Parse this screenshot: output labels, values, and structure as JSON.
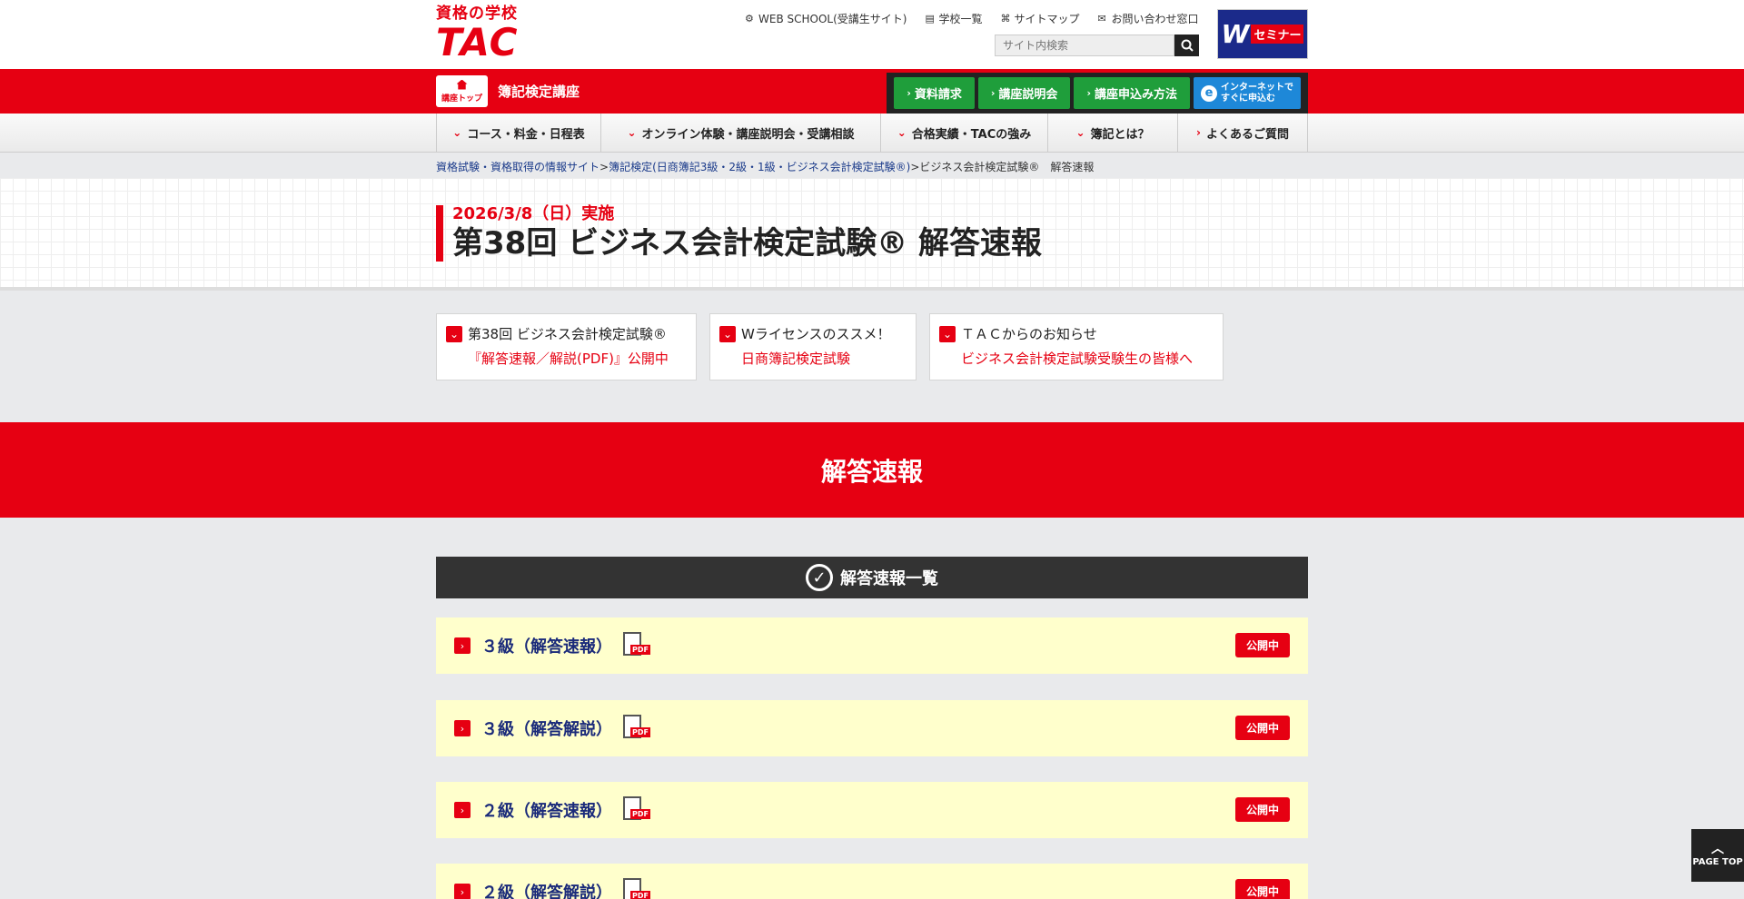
{
  "logo": {
    "sub": "資格の学校",
    "main": "TAC"
  },
  "util_links": [
    {
      "icon": "gear-icon",
      "glyph": "⚙",
      "label": "WEB SCHOOL(受講生サイト)"
    },
    {
      "icon": "building-icon",
      "glyph": "▤",
      "label": "学校一覧"
    },
    {
      "icon": "sitemap-icon",
      "glyph": "⌘",
      "label": "サイトマップ"
    },
    {
      "icon": "mail-icon",
      "glyph": "✉",
      "label": "お問い合わせ窓口"
    }
  ],
  "search": {
    "placeholder": "サイト内検索"
  },
  "w_banner": {
    "w": "W",
    "label": "セミナー"
  },
  "course_bar": {
    "top_label": "講座トップ",
    "course_name": "簿記検定講座"
  },
  "cta": [
    {
      "label": "資料請求"
    },
    {
      "label": "講座説明会"
    },
    {
      "label": "講座申込み方法"
    }
  ],
  "cta_internet": {
    "line1": "インターネットで",
    "line2": "すぐに申込む"
  },
  "nav": [
    {
      "label": "コース・料金・日程表",
      "chev": "⌄"
    },
    {
      "label": "オンライン体験・講座説明会・受講相談",
      "chev": "⌄"
    },
    {
      "label": "合格実績・TACの強み",
      "chev": "⌄"
    },
    {
      "label": "簿記とは？",
      "chev": "⌄"
    },
    {
      "label": "よくあるご質問",
      "chev": "›"
    }
  ],
  "breadcrumb": {
    "link1": "資格試験・資格取得の情報サイト",
    "sep": ">",
    "link2": "簿記検定(日商簿記3級・2級・1級・ビジネス会計検定試験®)",
    "current": "ビジネス会計検定試験®　解答速報"
  },
  "title": {
    "date": "2026/3/8（日）実施",
    "main": "第38回 ビジネス会計検定試験® 解答速報"
  },
  "news_cards": [
    {
      "line1": "第38回 ビジネス会計検定試験®",
      "line2": "『解答速報／解説(PDF)』公開中"
    },
    {
      "line1": "Wライセンスのススメ！",
      "line2": "日商簿記検定試験"
    },
    {
      "line1": "ＴＡＣからのお知らせ",
      "line2": "ビジネス会計検定試験受験生の皆様へ"
    }
  ],
  "section": {
    "heading": "解答速報"
  },
  "list": {
    "heading": "解答速報一覧",
    "rows": [
      {
        "label": "３級（解答速報）",
        "status": "公開中"
      },
      {
        "label": "３級（解答解説）",
        "status": "公開中"
      },
      {
        "label": "２級（解答速報）",
        "status": "公開中"
      },
      {
        "label": "２級（解答解説）",
        "status": "公開中"
      }
    ],
    "pdf_tag": "PDF"
  },
  "page_top": {
    "label": "PAGE TOP"
  },
  "colors": {
    "brand_red": "#e60012",
    "cta_green": "#1f9e3b",
    "cta_blue": "#1e88d8",
    "row_bg": "#ffffcc"
  }
}
